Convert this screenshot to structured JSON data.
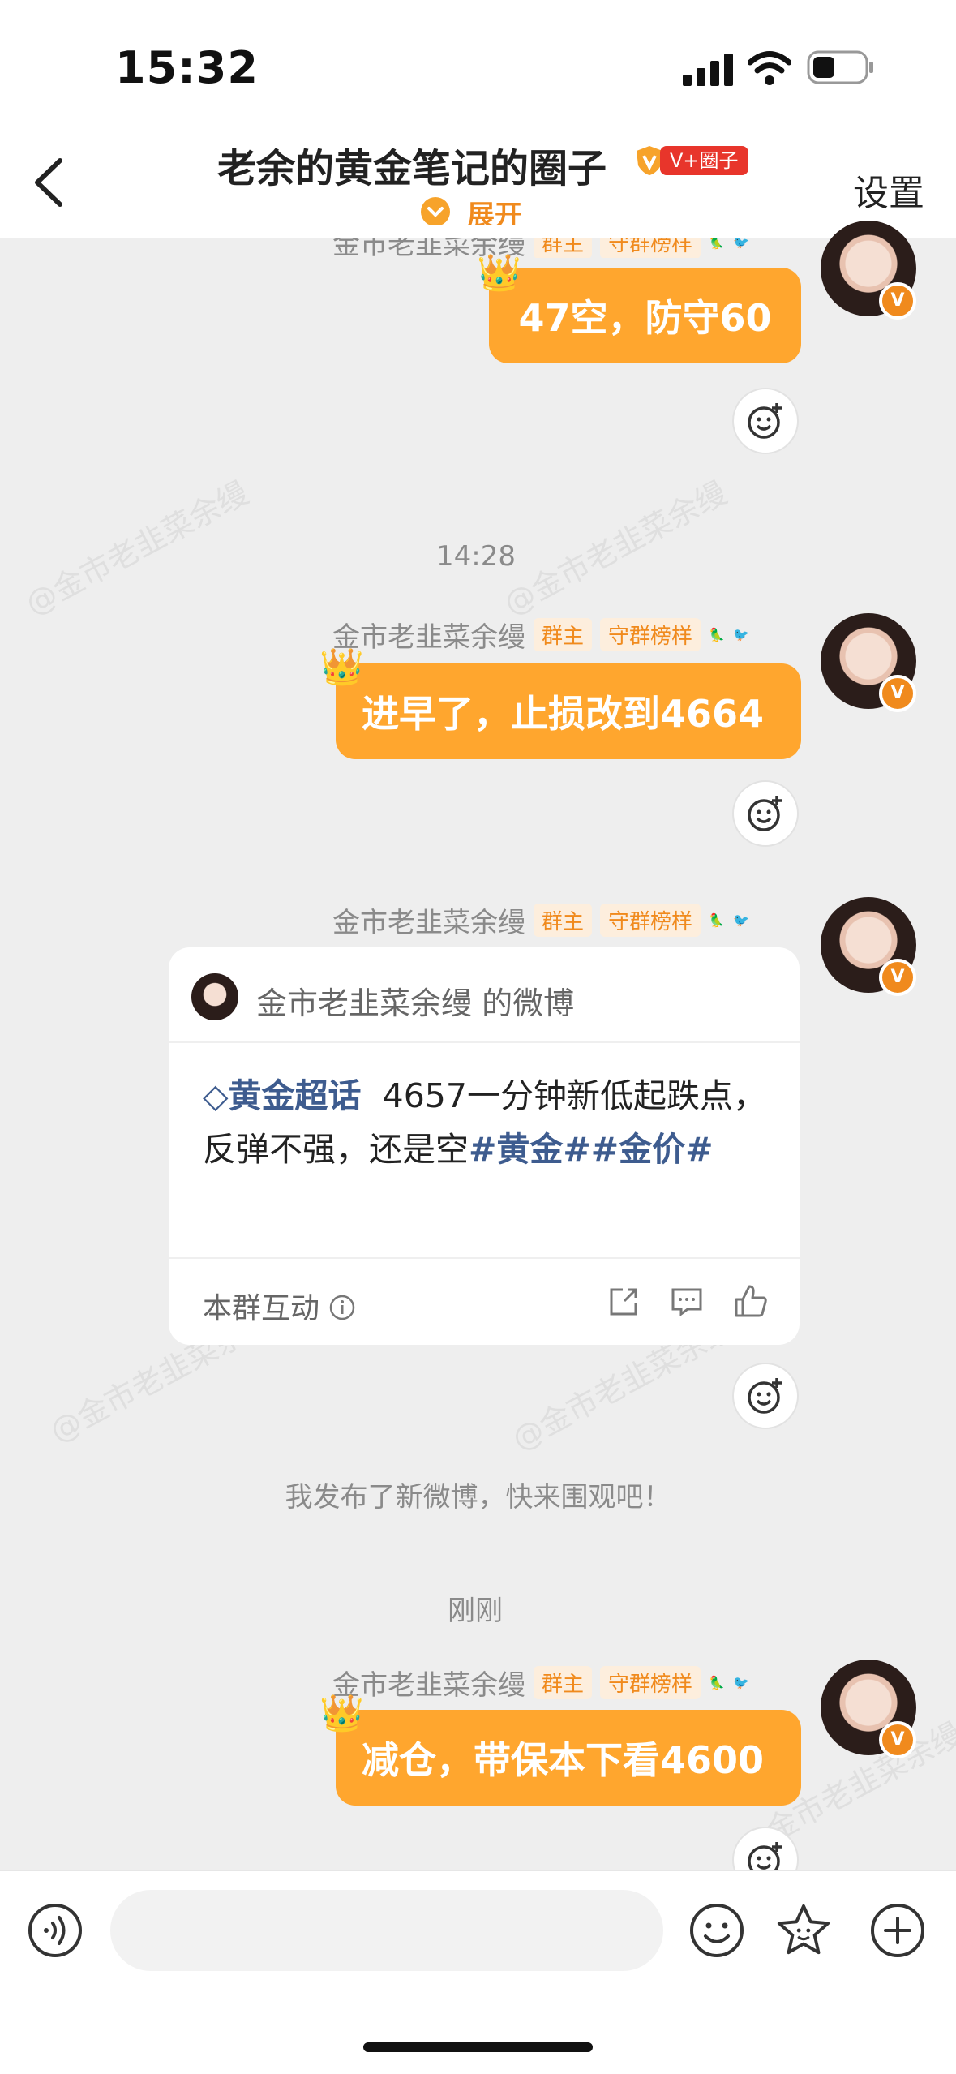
{
  "status_bar": {
    "time": "15:32"
  },
  "header": {
    "title": "老余的黄金笔记的圈子",
    "badge": "V+圈子",
    "expand_label": "展开",
    "settings_label": "设置"
  },
  "watermark_text": "@金市老韭菜余缦",
  "messages": [
    {
      "sender": "金市老韭菜余缦",
      "owner_badge": "群主",
      "guard_badge": "守群榜样",
      "text": "47空，防守60"
    },
    {
      "time": "14:28",
      "sender": "金市老韭菜余缦",
      "owner_badge": "群主",
      "guard_badge": "守群榜样",
      "text": "进早了，止损改到4664"
    },
    {
      "sender": "金市老韭菜余缦",
      "owner_badge": "群主",
      "guard_badge": "守群榜样"
    },
    {
      "time": "刚刚",
      "sender": "金市老韭菜余缦",
      "owner_badge": "群主",
      "guard_badge": "守群榜样",
      "text": "减仓，带保本下看4600"
    }
  ],
  "weibo_card": {
    "author_line": "金市老韭菜余缦 的微博",
    "supertopic": "黄金超话",
    "body_text": "4657一分钟新低起跌点，反弹不强，还是空",
    "hashtag_1": "#黄金#",
    "hashtag_2": "#金价#",
    "footer_label": "本群互动"
  },
  "system_notice": "我发布了新微博，快来围观吧！",
  "input": {
    "placeholder": ""
  },
  "colors": {
    "accent": "#ffa62e",
    "orange_text": "#f08a1d",
    "topic_blue": "#3e5c8f"
  },
  "icons": [
    "back-icon",
    "voice-icon",
    "emoji-icon",
    "sticker-icon",
    "plus-icon",
    "add-reaction-icon",
    "share-icon",
    "comment-icon",
    "like-icon",
    "info-icon"
  ]
}
